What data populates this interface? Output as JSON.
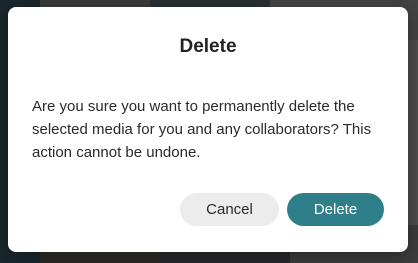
{
  "dialog": {
    "title": "Delete",
    "message": "Are you sure you want to permanently delete the selected media for you and any collaborators? This action cannot be undone.",
    "cancel_label": "Cancel",
    "confirm_label": "Delete"
  },
  "colors": {
    "confirm_button": "#2f7f8a",
    "cancel_button": "#ececec"
  }
}
